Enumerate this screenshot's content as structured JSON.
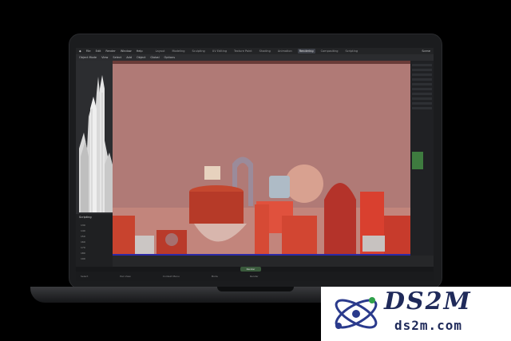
{
  "menubar": {
    "items": [
      "File",
      "Edit",
      "Render",
      "Window",
      "Help"
    ],
    "tabs": [
      "Layout",
      "Modeling",
      "Sculpting",
      "UV Editing",
      "Texture Paint",
      "Shading",
      "Animation",
      "Rendering",
      "Compositing",
      "Scripting"
    ],
    "active_tab": "Rendering",
    "scene": "Scene",
    "view_layer": "ViewLayer"
  },
  "toolbar": {
    "items": [
      "Object Mode",
      "View",
      "Select",
      "Add",
      "Object",
      "Global",
      "Options"
    ]
  },
  "bottom_left": {
    "title": "Scripting",
    "rows": [
      "130",
      "140",
      "150",
      "160",
      "170",
      "180",
      "190"
    ]
  },
  "render_button": {
    "label": "Render Animation"
  },
  "status": [
    "Select",
    "Pan View",
    "Context Menu",
    "Mode",
    "Render"
  ],
  "watermark": {
    "title": "DS2M",
    "url": "ds2m.com"
  },
  "colors": {
    "accent": "#2d2aa6",
    "sky": "#b07a76",
    "watermark_text": "#1f2a5a"
  }
}
